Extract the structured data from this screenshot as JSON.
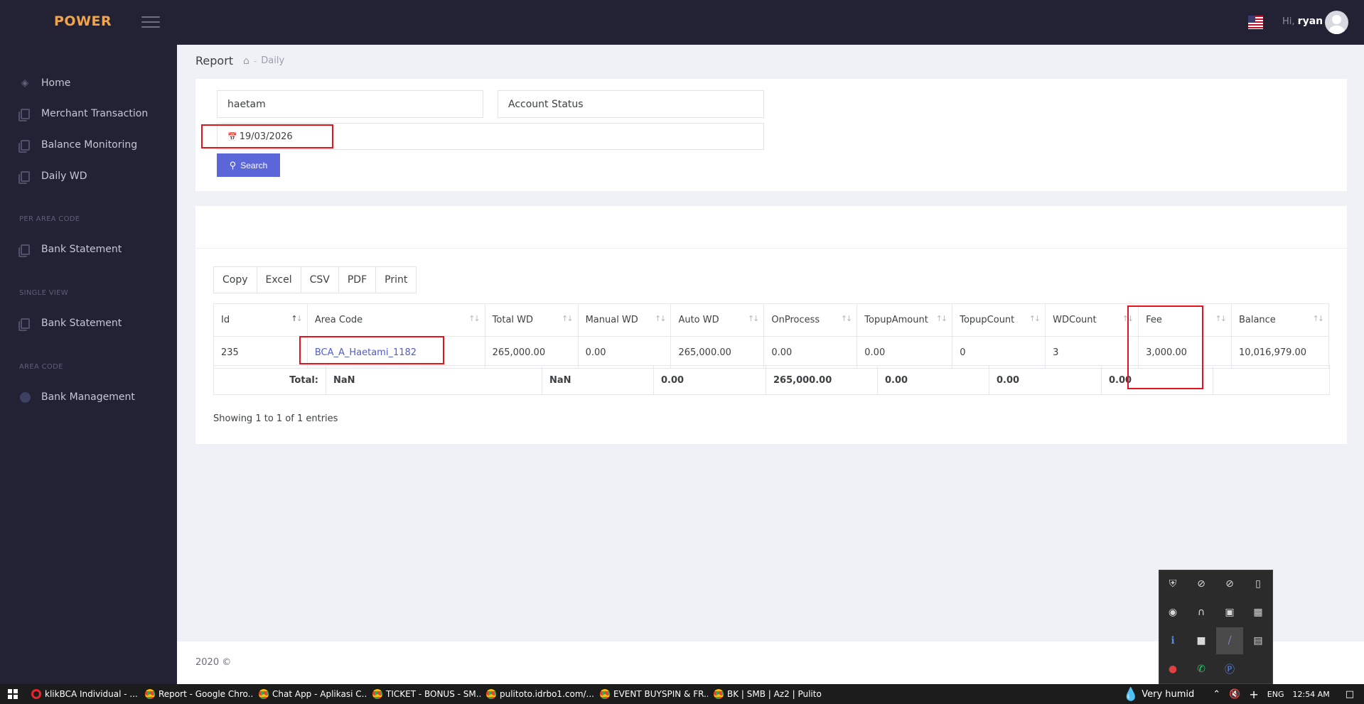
{
  "header": {
    "brand": "POWER",
    "greeting": "Hi,",
    "username": "ryan"
  },
  "sidebar": {
    "items": [
      {
        "label": "Home",
        "icon": "stack-icon"
      },
      {
        "label": "Merchant Transaction",
        "icon": "document-icon"
      },
      {
        "label": "Balance Monitoring",
        "icon": "document-icon"
      },
      {
        "label": "Daily WD",
        "icon": "document-icon"
      }
    ],
    "sections": [
      {
        "title": "PER AREA CODE",
        "items": [
          {
            "label": "Bank Statement",
            "icon": "document-icon"
          }
        ]
      },
      {
        "title": "SINGLE VIEW",
        "items": [
          {
            "label": "Bank Statement",
            "icon": "document-icon"
          }
        ]
      },
      {
        "title": "AREA CODE",
        "items": [
          {
            "label": "Bank Management",
            "icon": "circle-icon"
          }
        ]
      }
    ]
  },
  "breadcrumb": {
    "title": "Report",
    "page": "Daily"
  },
  "filters": {
    "name_value": "haetam",
    "status_value": "Account Status",
    "date_value": "19/03/2026",
    "search_label": "Search"
  },
  "export_buttons": [
    "Copy",
    "Excel",
    "CSV",
    "PDF",
    "Print"
  ],
  "table": {
    "columns": [
      "Id",
      "Area Code",
      "Total WD",
      "Manual WD",
      "Auto WD",
      "OnProcess",
      "TopupAmount",
      "TopupCount",
      "WDCount",
      "Fee",
      "Balance"
    ],
    "rows": [
      [
        "235",
        "BCA_A_Haetami_1182",
        "265,000.00",
        "0.00",
        "265,000.00",
        "0.00",
        "0.00",
        "0",
        "3",
        "3,000.00",
        "10,016,979.00"
      ]
    ],
    "totals": {
      "label": "Total:",
      "values": [
        "NaN",
        "NaN",
        "0.00",
        "265,000.00",
        "0.00",
        "0.00",
        "0.00",
        ""
      ]
    }
  },
  "showing": "Showing 1 to 1 of 1 entries",
  "footer": "2020 ©",
  "taskbar": {
    "items": [
      {
        "label": "klikBCA Individual - ...",
        "icon": "opera-icon"
      },
      {
        "label": "Report - Google Chro...",
        "icon": "chrome-icon"
      },
      {
        "label": "Chat App - Aplikasi C...",
        "icon": "chrome-icon"
      },
      {
        "label": "TICKET - BONUS - SM...",
        "icon": "chrome-icon"
      },
      {
        "label": "pulitoto.idrbo1.com/...",
        "icon": "chrome-icon"
      },
      {
        "label": "EVENT BUYSPIN & FR...",
        "icon": "chrome-icon"
      },
      {
        "label": "BK | SMB | Az2 | Pulito...",
        "icon": "chrome-icon"
      }
    ],
    "weather": "Very humid",
    "language": "ENG",
    "time": "12:54 AM"
  }
}
